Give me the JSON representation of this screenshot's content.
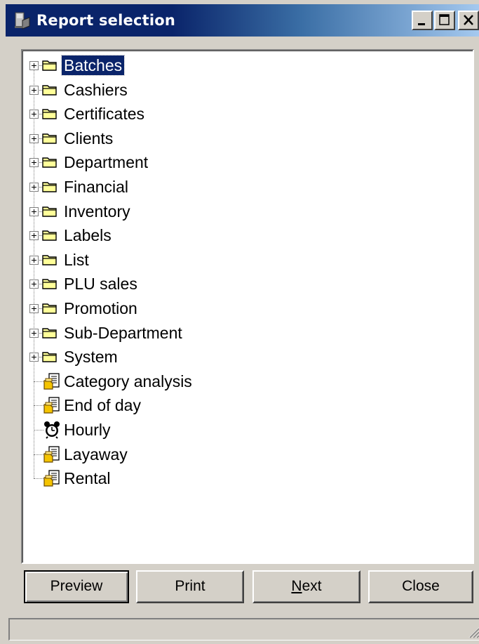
{
  "window": {
    "title": "Report selection",
    "icon": "report-app-icon"
  },
  "tree": {
    "folders": [
      {
        "label": "Batches",
        "selected": true
      },
      {
        "label": "Cashiers"
      },
      {
        "label": "Certificates"
      },
      {
        "label": "Clients"
      },
      {
        "label": "Department"
      },
      {
        "label": "Financial"
      },
      {
        "label": "Inventory"
      },
      {
        "label": "Labels"
      },
      {
        "label": "List"
      },
      {
        "label": "PLU sales"
      },
      {
        "label": "Promotion"
      },
      {
        "label": "Sub-Department"
      },
      {
        "label": "System"
      }
    ],
    "reports": [
      {
        "label": "Category analysis",
        "icon": "report-icon"
      },
      {
        "label": "End of day",
        "icon": "report-icon"
      },
      {
        "label": "Hourly",
        "icon": "alarm-clock-icon"
      },
      {
        "label": "Layaway",
        "icon": "report-icon"
      },
      {
        "label": "Rental",
        "icon": "report-icon"
      }
    ]
  },
  "buttons": {
    "preview": "Preview",
    "print": "Print",
    "next_mnemonic": "N",
    "next_rest": "ext",
    "close": "Close"
  },
  "status": {
    "text": ""
  },
  "colors": {
    "title_active": "#0a246a",
    "face": "#d4d0c8",
    "selection": "#0a246a",
    "folder": "#ffff99"
  }
}
